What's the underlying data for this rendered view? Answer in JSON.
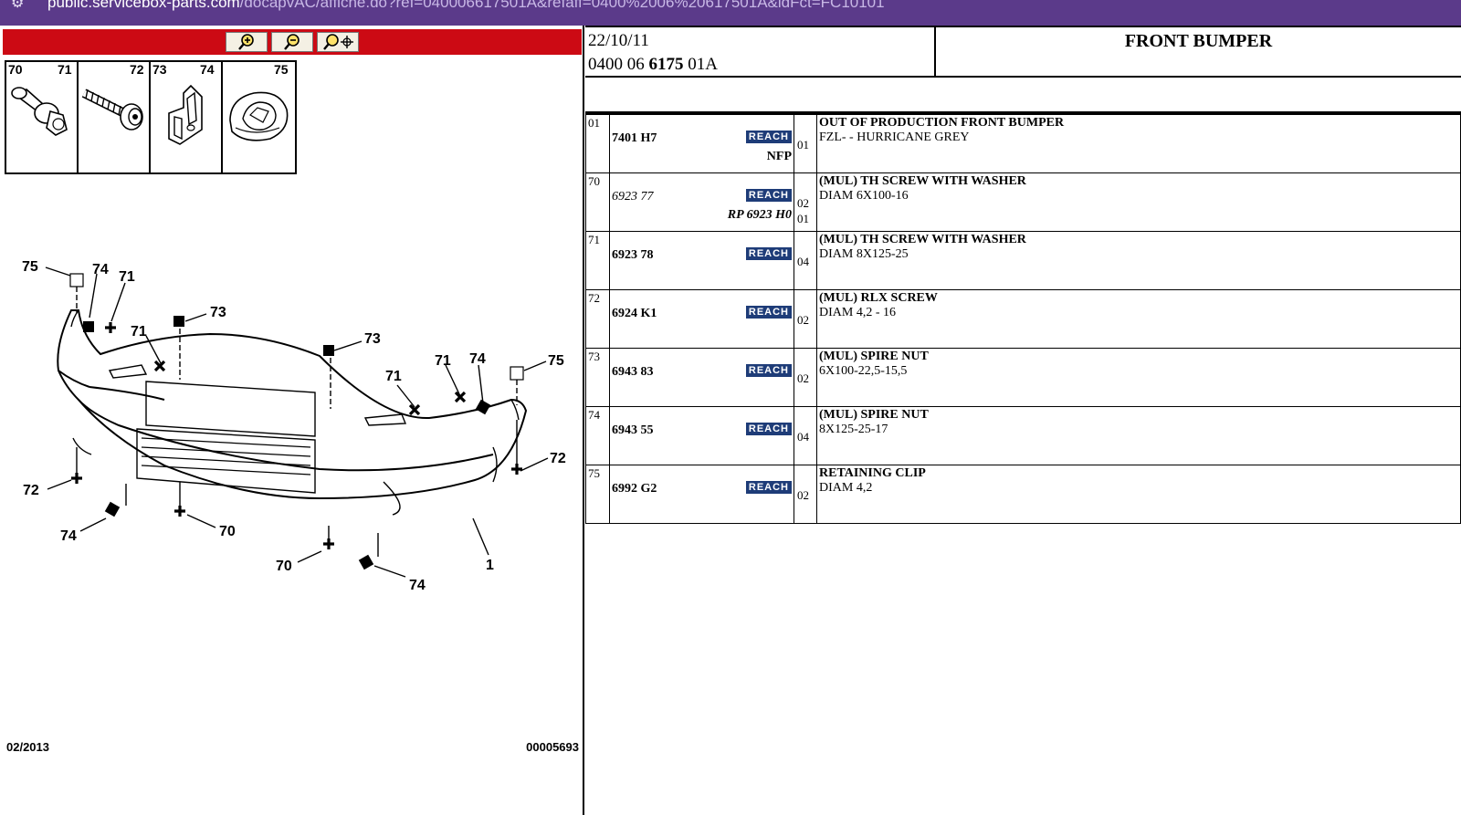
{
  "browser": {
    "url_host": "public.servicebox-parts.com",
    "url_path": "/docapvAC/affiche.do?ref=040006617501A&refaff=0400%2006%20617501A&idFct=FC10101"
  },
  "viewer": {
    "zoom_in_label": "zoom in",
    "zoom_out_label": "zoom out",
    "pan_label": "move",
    "thumb_labels": [
      {
        "a": "70",
        "b": "71"
      },
      {
        "a": "72",
        "b": ""
      },
      {
        "a": "73",
        "b": "74"
      },
      {
        "a": "75",
        "b": ""
      }
    ],
    "callouts": {
      "c1": "1",
      "c70": "70",
      "c71": "71",
      "c72": "72",
      "c73": "73",
      "c74": "74",
      "c75": "75"
    },
    "footer_date": "02/2013",
    "footer_code": "00005693"
  },
  "header": {
    "date": "22/10/11",
    "ref_prefix": "0400 06 ",
    "ref_bold": "6175",
    "ref_suffix": " 01A",
    "title": "FRONT BUMPER"
  },
  "parts": [
    {
      "idx": "01",
      "ref": "7401 H7",
      "ref_italic": false,
      "reach": "REACH",
      "qty": "01",
      "sub": "NFP",
      "sub_italic": false,
      "sub_qty": "",
      "desc1": "OUT OF PRODUCTION FRONT BUMPER",
      "desc2": "FZL- - HURRICANE GREY"
    },
    {
      "idx": "70",
      "ref": "6923 77",
      "ref_italic": true,
      "reach": "REACH",
      "qty": "02",
      "sub": "RP 6923 H0",
      "sub_italic": true,
      "sub_qty": "01",
      "desc1": "(MUL) TH SCREW WITH WASHER",
      "desc2": "DIAM 6X100-16"
    },
    {
      "idx": "71",
      "ref": "6923 78",
      "ref_italic": false,
      "reach": "REACH",
      "qty": "04",
      "sub": "",
      "sub_italic": false,
      "sub_qty": "",
      "desc1": "(MUL) TH SCREW WITH WASHER",
      "desc2": "DIAM 8X125-25"
    },
    {
      "idx": "72",
      "ref": "6924 K1",
      "ref_italic": false,
      "reach": "REACH",
      "qty": "02",
      "sub": "",
      "sub_italic": false,
      "sub_qty": "",
      "desc1": "(MUL) RLX SCREW",
      "desc2": "DIAM 4,2 - 16"
    },
    {
      "idx": "73",
      "ref": "6943 83",
      "ref_italic": false,
      "reach": "REACH",
      "qty": "02",
      "sub": "",
      "sub_italic": false,
      "sub_qty": "",
      "desc1": "(MUL) SPIRE NUT",
      "desc2": "6X100-22,5-15,5"
    },
    {
      "idx": "74",
      "ref": "6943 55",
      "ref_italic": false,
      "reach": "REACH",
      "qty": "04",
      "sub": "",
      "sub_italic": false,
      "sub_qty": "",
      "desc1": "(MUL) SPIRE NUT",
      "desc2": "8X125-25-17"
    },
    {
      "idx": "75",
      "ref": "6992 G2",
      "ref_italic": false,
      "reach": "REACH",
      "qty": "02",
      "sub": "",
      "sub_italic": false,
      "sub_qty": "",
      "desc1": "RETAINING CLIP",
      "desc2": "DIAM 4,2"
    }
  ]
}
